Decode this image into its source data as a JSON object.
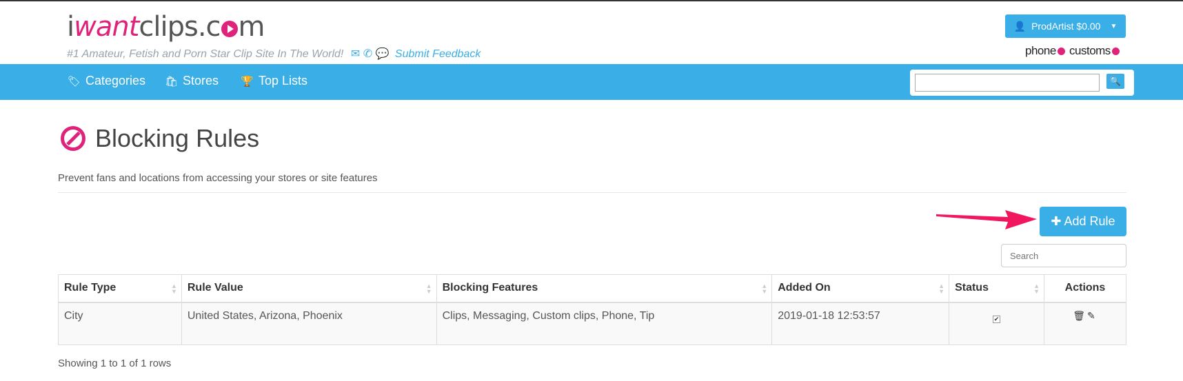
{
  "header": {
    "logo": {
      "part1": "i",
      "part2": "want",
      "part3": "clips.c",
      "part4": "m"
    },
    "tagline": "#1 Amateur, Fetish and Porn Star Clip Site In The World!",
    "feedback_label": "Submit Feedback",
    "account_button": "ProdArtist $0.00",
    "phone_label": "phone",
    "customs_label": "customs"
  },
  "nav": {
    "items": [
      {
        "label": "Categories",
        "icon": "tag-icon"
      },
      {
        "label": "Stores",
        "icon": "shopping-bag-icon"
      },
      {
        "label": "Top Lists",
        "icon": "trophy-icon"
      }
    ],
    "search_value": ""
  },
  "page": {
    "title": "Blocking Rules",
    "subtitle": "Prevent fans and locations from accessing your stores or site features",
    "add_rule_label": "Add Rule",
    "search_placeholder": "Search"
  },
  "table": {
    "columns": [
      "Rule Type",
      "Rule Value",
      "Blocking Features",
      "Added On",
      "Status",
      "Actions"
    ],
    "rows": [
      {
        "rule_type": "City",
        "rule_value": "United States, Arizona, Phoenix",
        "blocking_features": "Clips, Messaging, Custom clips, Phone, Tip",
        "added_on": "2019-01-18 12:53:57",
        "status_checked": true
      }
    ],
    "footer": "Showing 1 to 1 of 1 rows"
  },
  "colors": {
    "accent": "#3aaee6",
    "brand_pink": "#e0237a",
    "arrow": "#f0175f"
  }
}
